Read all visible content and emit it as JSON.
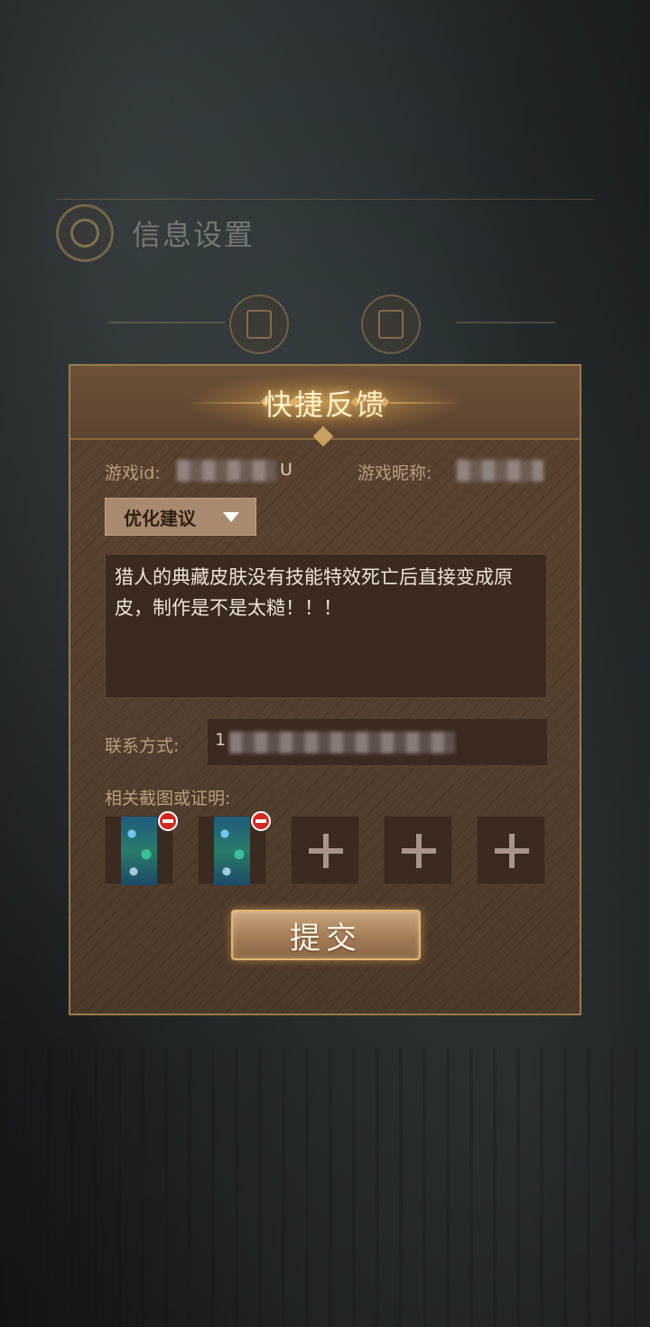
{
  "background": {
    "title": "信息设置",
    "tabs": [
      "record-icon",
      "card-icon"
    ]
  },
  "dialog": {
    "title": "快捷反馈",
    "game_id_label": "游戏id:",
    "game_id_suffix": "U",
    "nickname_label": "游戏昵称:",
    "category": "优化建议",
    "feedback_text": "猎人的典藏皮肤没有技能特效死亡后直接变成原皮，制作是不是太糙！！！",
    "contact_label": "联系方式:",
    "contact_prefix": "1",
    "screenshots_label": "相关截图或证明:",
    "screenshots": [
      {
        "type": "image",
        "icon": "screenshot-thumbnail"
      },
      {
        "type": "image",
        "icon": "screenshot-thumbnail"
      },
      {
        "type": "empty",
        "icon": "plus-icon"
      },
      {
        "type": "empty",
        "icon": "plus-icon"
      },
      {
        "type": "empty",
        "icon": "plus-icon"
      }
    ],
    "submit_label": "提交"
  },
  "colors": {
    "panel": "#544030",
    "accent": "#c89a55",
    "remove": "#d02a22"
  }
}
